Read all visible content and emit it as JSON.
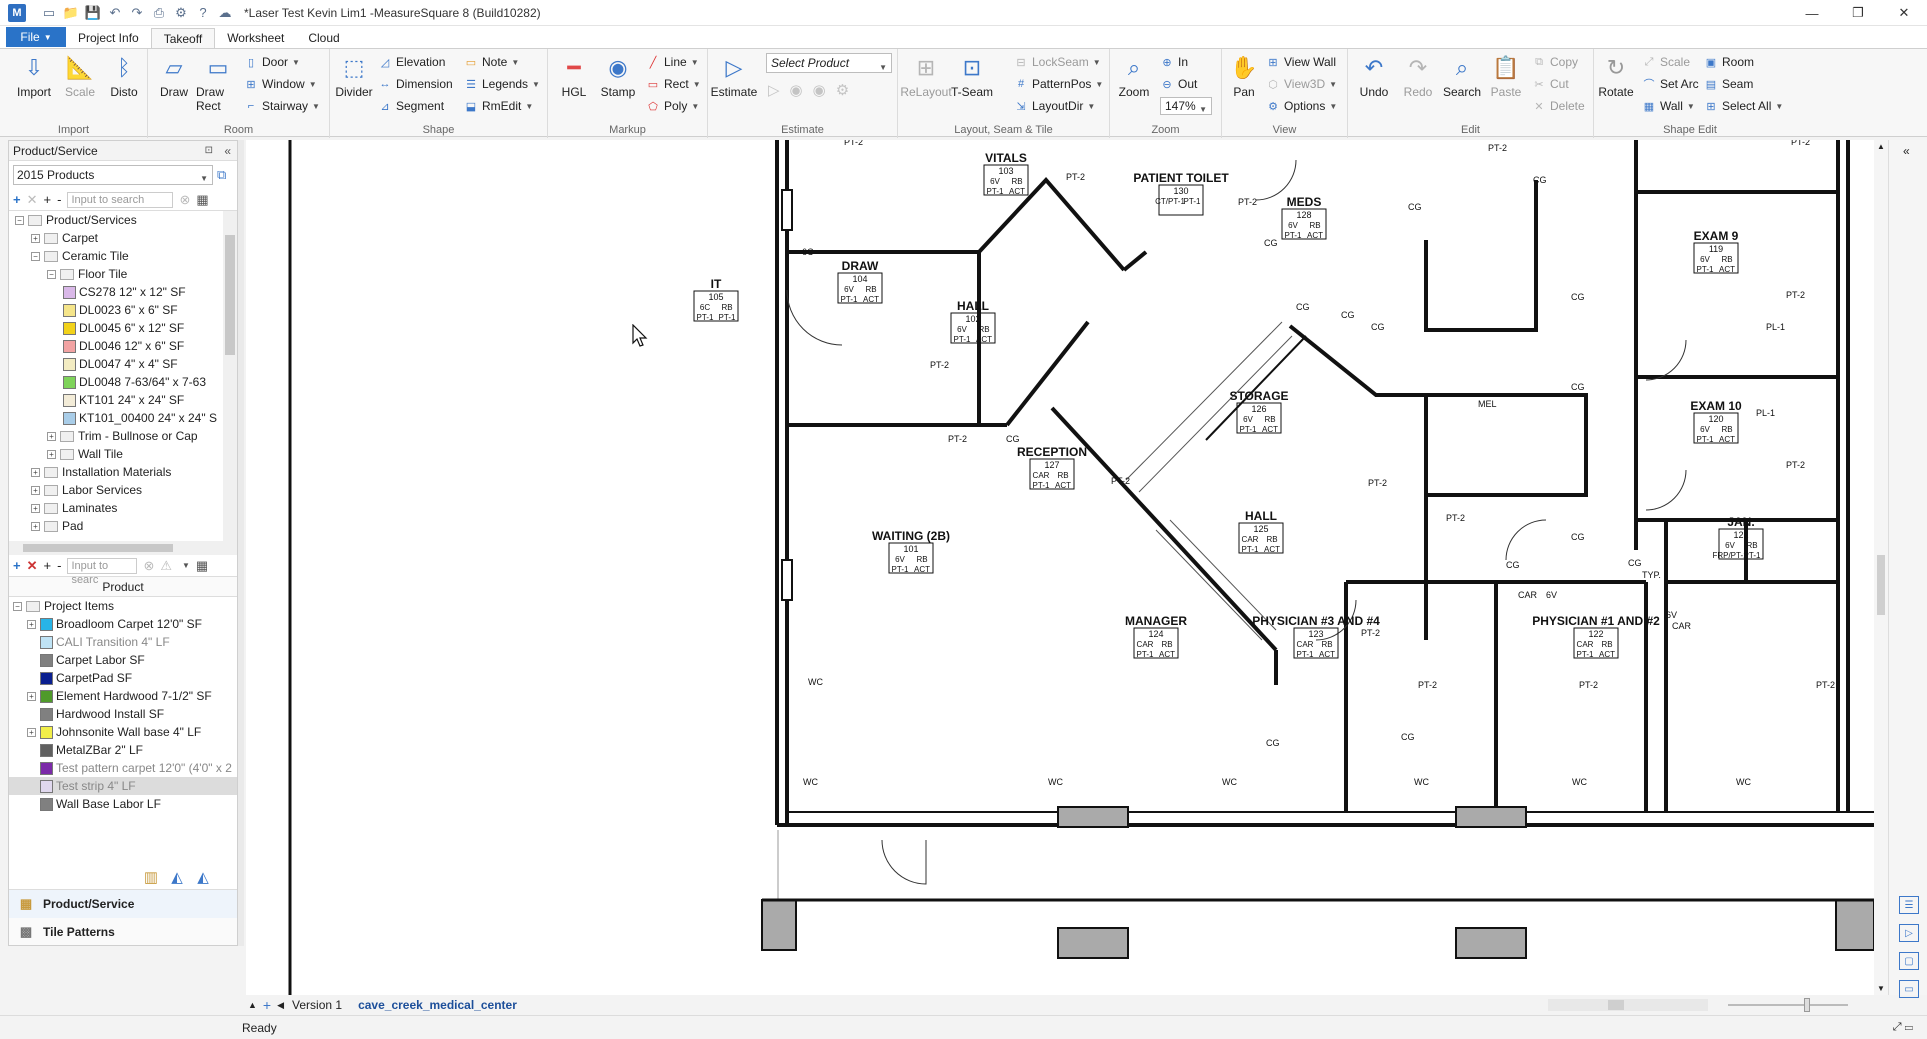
{
  "window": {
    "title": "*Laser Test Kevin Lim1 -MeasureSquare 8 (Build10282)",
    "app_icon": "M",
    "controls": [
      "minimize-icon",
      "restore-icon",
      "close-icon"
    ]
  },
  "quick_access": [
    "new-icon",
    "open-icon",
    "save-icon",
    "undo-icon",
    "redo-icon",
    "print-icon",
    "settings-icon",
    "help-icon",
    "cloud-icon"
  ],
  "menu": {
    "file": "File",
    "tabs": [
      "Project Info",
      "Takeoff",
      "Worksheet",
      "Cloud"
    ],
    "active_tab": "Takeoff"
  },
  "ribbon": {
    "import": {
      "label": "Import",
      "buttons": [
        "Import",
        "Scale",
        "Disto"
      ]
    },
    "room": {
      "label": "Room",
      "big": [
        "Draw",
        "Draw Rect"
      ],
      "small": [
        "Door",
        "Window",
        "Stairway"
      ]
    },
    "shape": {
      "label": "Shape",
      "big": [
        "Divider"
      ],
      "small": [
        "Elevation",
        "Dimension",
        "Segment",
        "Note",
        "Legends",
        "RmEdit"
      ]
    },
    "markup": {
      "label": "Markup",
      "big": [
        "HGL",
        "Stamp"
      ],
      "small": [
        "Line",
        "Rect",
        "Poly"
      ]
    },
    "estimate": {
      "label": "Estimate",
      "big": [
        "Estimate"
      ],
      "select_placeholder": "Select Product"
    },
    "layout": {
      "label": "Layout, Seam & Tile",
      "big": [
        "ReLayout",
        "T-Seam"
      ],
      "small": [
        "LockSeam",
        "PatternPos",
        "LayoutDir"
      ]
    },
    "zoom": {
      "label": "Zoom",
      "big": [
        "Zoom"
      ],
      "small": [
        "In",
        "Out"
      ],
      "level": "147%"
    },
    "view": {
      "label": "View",
      "big": [
        "Pan"
      ],
      "small": [
        "View Wall",
        "View3D",
        "Options"
      ]
    },
    "edit": {
      "label": "Edit",
      "big": [
        "Undo",
        "Redo",
        "Search",
        "Paste"
      ],
      "small": [
        "Copy",
        "Cut",
        "Delete"
      ]
    },
    "shape_edit": {
      "label": "Shape Edit",
      "big": [
        "Rotate"
      ],
      "small": [
        "Scale",
        "Set Arc",
        "Wall",
        "Room",
        "Seam",
        "Select All"
      ]
    }
  },
  "left_panel": {
    "header": "Product/Service",
    "catalog": "2015 Products",
    "search_placeholder": "Input to search",
    "search_placeholder2": "Input to searc",
    "tree": [
      {
        "label": "Product/Services",
        "level": 0,
        "exp": "-"
      },
      {
        "label": "Carpet",
        "level": 1,
        "exp": "+"
      },
      {
        "label": "Ceramic Tile",
        "level": 1,
        "exp": "-"
      },
      {
        "label": "Floor Tile",
        "level": 2,
        "exp": "-"
      },
      {
        "label": "CS278 12\" x 12\" SF",
        "level": 3,
        "color": "#d9b8e8"
      },
      {
        "label": "DL0023 6\" x 6\" SF",
        "level": 3,
        "color": "#f5e58a"
      },
      {
        "label": "DL0045 6\" x 12\" SF",
        "level": 3,
        "color": "#f2d21a"
      },
      {
        "label": "DL0046 12\" x 6\" SF",
        "level": 3,
        "color": "#f2a3a3"
      },
      {
        "label": "DL0047 4\" x 4\" SF",
        "level": 3,
        "color": "#f3ecc2"
      },
      {
        "label": "DL0048 7-63/64\" x 7-63",
        "level": 3,
        "color": "#7ed35a"
      },
      {
        "label": "KT101 24\" x 24\" SF",
        "level": 3,
        "color": "#f3ecd8"
      },
      {
        "label": "KT101_00400 24\" x 24\" S",
        "level": 3,
        "color": "#a9cde8"
      },
      {
        "label": "Trim - Bullnose or Cap",
        "level": 2,
        "exp": "+"
      },
      {
        "label": "Wall Tile",
        "level": 2,
        "exp": "+"
      },
      {
        "label": "Installation Materials",
        "level": 1,
        "exp": "+"
      },
      {
        "label": "Labor Services",
        "level": 1,
        "exp": "+"
      },
      {
        "label": "Laminates",
        "level": 1,
        "exp": "+"
      },
      {
        "label": "Pad",
        "level": 1,
        "exp": "+"
      }
    ],
    "product_column": "Product",
    "project_root": "Project Items",
    "project_items": [
      {
        "label": "Broadloom Carpet 12'0\" SF",
        "color": "#28b4e6",
        "exp": "+"
      },
      {
        "label": "CALI Transition 4\" LF",
        "color": "#bfe3f5",
        "dim": true
      },
      {
        "label": "Carpet Labor  SF",
        "color": "#808080"
      },
      {
        "label": "CarpetPad  SF",
        "color": "#0a1f8f"
      },
      {
        "label": "Element Hardwood 7-1/2\" SF",
        "color": "#4f9a2a",
        "exp": "+"
      },
      {
        "label": "Hardwood Install  SF",
        "color": "#808080"
      },
      {
        "label": "Johnsonite Wall base 4\" LF",
        "color": "#f2ef4a",
        "exp": "+"
      },
      {
        "label": "MetalZBar 2\" LF",
        "color": "#606060"
      },
      {
        "label": "Test pattern carpet 12'0\" (4'0\" x 2",
        "color": "#7b2aa8",
        "dim": true
      },
      {
        "label": "Test strip 4\" LF",
        "color": "#e0d8ee",
        "selected": true
      },
      {
        "label": "Wall Base Labor  LF",
        "color": "#808080"
      }
    ],
    "bottom_tabs": [
      "Product/Service",
      "Tile Patterns"
    ]
  },
  "floorplan": {
    "rooms": [
      {
        "name": "VITALS",
        "num": "103",
        "codes": [
          "6V",
          "RB",
          "PT-1",
          "ACT"
        ]
      },
      {
        "name": "PATIENT TOILET",
        "num": "130",
        "codes": [
          "CT/PT-1",
          "PT-1"
        ]
      },
      {
        "name": "MEDS",
        "num": "128",
        "codes": [
          "6V",
          "RB",
          "PT-1",
          "ACT"
        ]
      },
      {
        "name": "EXAM 9",
        "num": "119",
        "codes": [
          "6V",
          "RB",
          "PT-1",
          "ACT"
        ]
      },
      {
        "name": "IT",
        "num": "105",
        "codes": [
          "6C",
          "RB",
          "PT-1",
          "PT-1"
        ]
      },
      {
        "name": "DRAW",
        "num": "104",
        "codes": [
          "6V",
          "RB",
          "PT-1",
          "ACT"
        ]
      },
      {
        "name": "HALL",
        "num": "102",
        "codes": [
          "6V",
          "RB",
          "PT-1",
          "ACT"
        ]
      },
      {
        "name": "STORAGE",
        "num": "126",
        "codes": [
          "6V",
          "RB",
          "PT-1",
          "ACT"
        ]
      },
      {
        "name": "EXAM 10",
        "num": "120",
        "codes": [
          "6V",
          "RB",
          "PT-1",
          "ACT"
        ]
      },
      {
        "name": "RECEPTION",
        "num": "127",
        "codes": [
          "CAR",
          "RB",
          "PT-1",
          "ACT"
        ]
      },
      {
        "name": "HALL",
        "num": "125",
        "codes": [
          "CAR",
          "RB",
          "PT-1",
          "ACT"
        ]
      },
      {
        "name": "JAN.",
        "num": "121",
        "codes": [
          "6V",
          "RB",
          "FRP/PT-1",
          "PT-1"
        ]
      },
      {
        "name": "WAITING (2B)",
        "num": "101",
        "codes": [
          "6V",
          "RB",
          "PT-1",
          "ACT"
        ]
      },
      {
        "name": "MANAGER",
        "num": "124",
        "codes": [
          "CAR",
          "RB",
          "PT-1",
          "ACT"
        ]
      },
      {
        "name": "PHYSICIAN #3 AND #4",
        "num": "123",
        "codes": [
          "CAR",
          "RB",
          "PT-1",
          "ACT"
        ]
      },
      {
        "name": "PHYSICIAN #1 AND #2",
        "num": "122",
        "codes": [
          "CAR",
          "RB",
          "PT-1",
          "ACT"
        ]
      }
    ],
    "tags": {
      "pt2": "PT-2",
      "cg": "CG",
      "wc": "WC",
      "pl1": "PL-1",
      "mel": "MEL",
      "car": "CAR",
      "v6": "6V",
      "c6": "6C",
      "typ": "TYP.",
      "pt1": "PT-1"
    }
  },
  "doc_tabs": {
    "version": "Version 1",
    "active": "cave_creek_medical_center"
  },
  "status": "Ready"
}
